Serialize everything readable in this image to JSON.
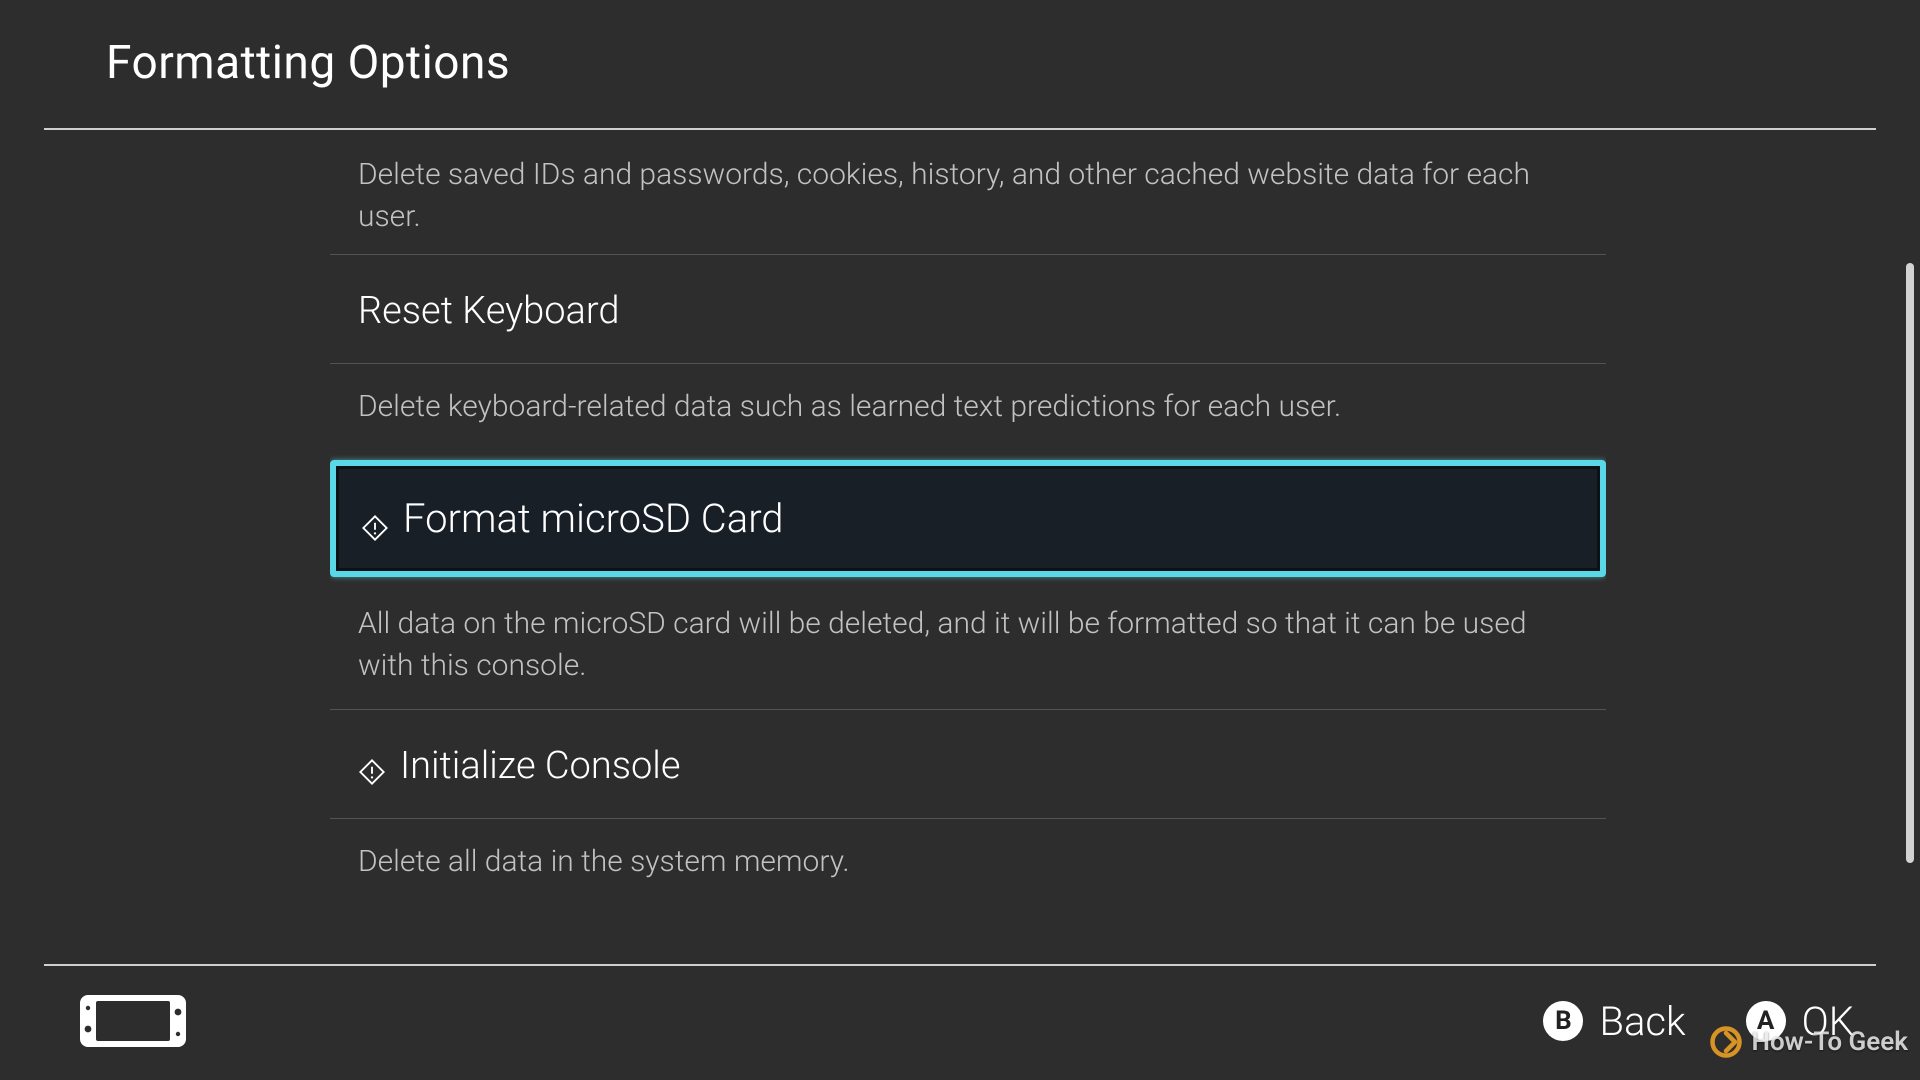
{
  "header": {
    "title": "Formatting Options"
  },
  "options": {
    "partial_top_desc": "Delete saved IDs and passwords, cookies, history, and other cached website data for each user.",
    "reset_keyboard": {
      "title": "Reset Keyboard",
      "desc": "Delete keyboard-related data such as learned text predictions for each user."
    },
    "format_sd": {
      "title": "Format microSD Card",
      "desc": "All data on the microSD card will be deleted, and it will be formatted so that it can be used with this console."
    },
    "initialize_console": {
      "title": "Initialize Console",
      "desc": "Delete all data in the system memory."
    }
  },
  "footer": {
    "back": {
      "key": "B",
      "label": "Back"
    },
    "ok": {
      "key": "A",
      "label": "OK"
    }
  },
  "watermark": {
    "text": "How-To Geek"
  },
  "colors": {
    "focus": "#5ad8e8",
    "bg": "#2d2d2d"
  }
}
